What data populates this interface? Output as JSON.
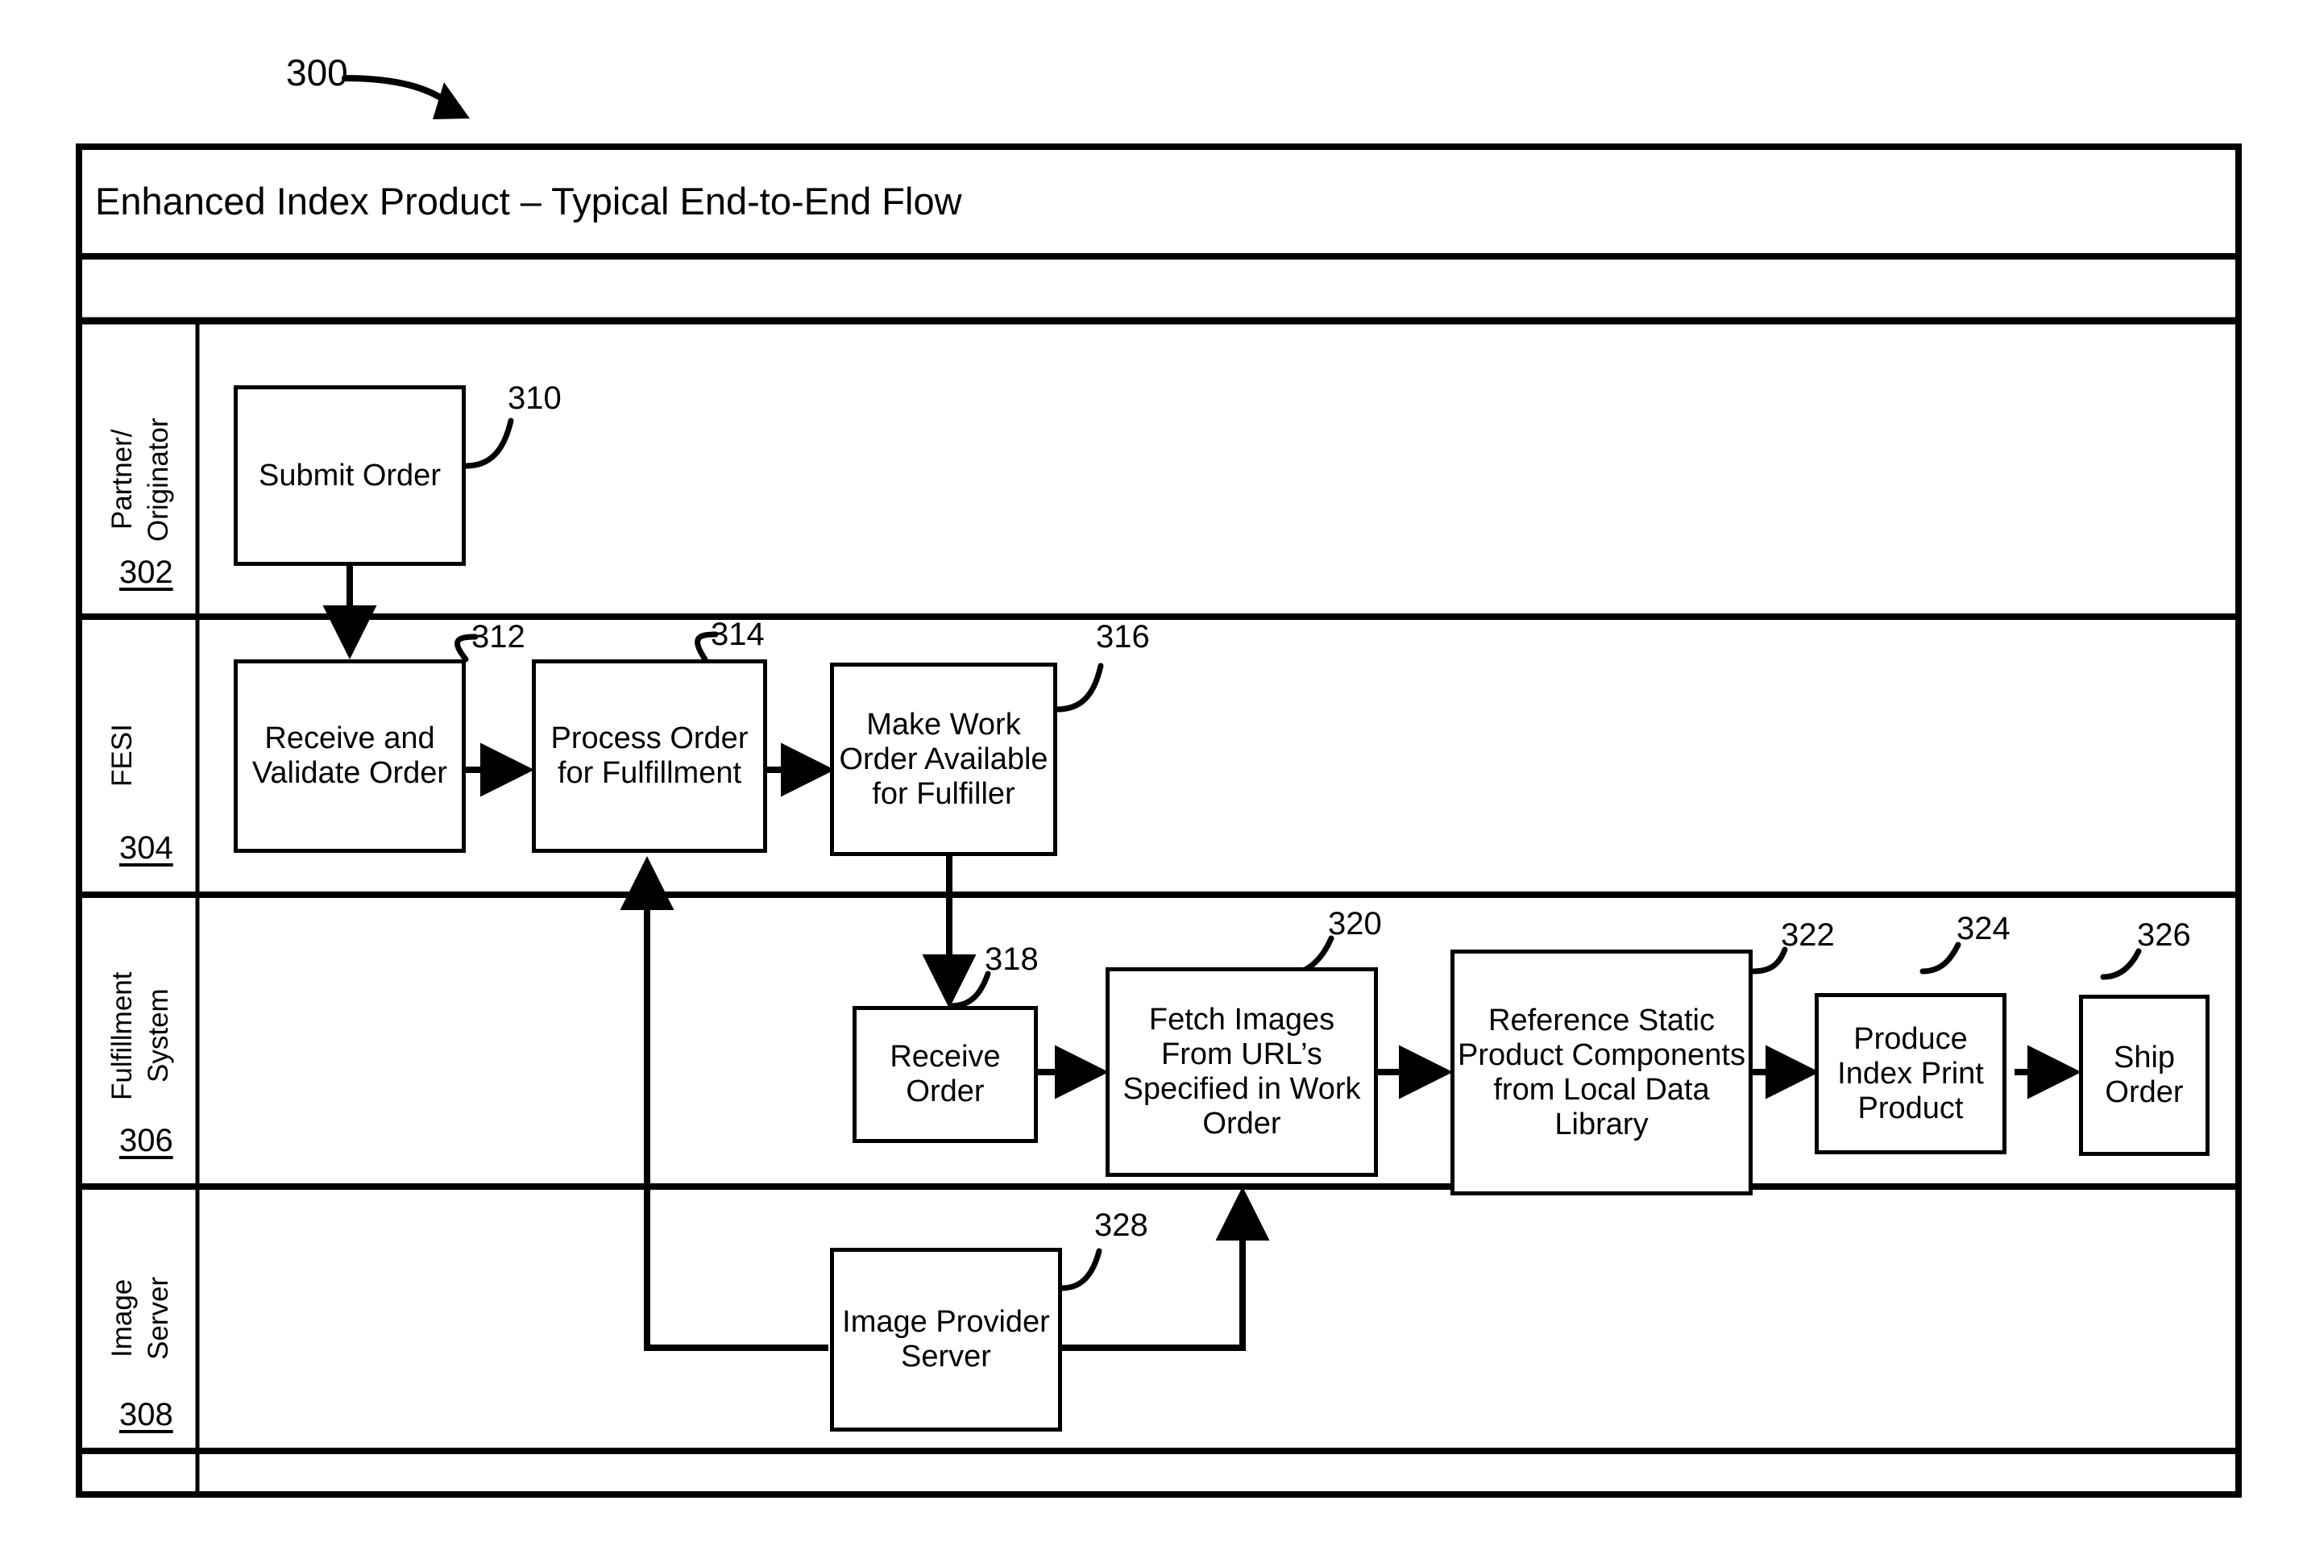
{
  "figure": {
    "number": "300",
    "title": "Enhanced Index Product – Typical End-to-End Flow"
  },
  "lanes": [
    {
      "id": "partner",
      "label": "Partner/\nOriginator",
      "ref": "302"
    },
    {
      "id": "fesi",
      "label": "FESI",
      "ref": "304"
    },
    {
      "id": "fulfillment",
      "label": "Fulfillment\nSystem",
      "ref": "306"
    },
    {
      "id": "image_server",
      "label": "Image\nServer",
      "ref": "308"
    }
  ],
  "nodes": [
    {
      "id": "n310",
      "ref": "310",
      "label": "Submit\nOrder",
      "lane": "partner"
    },
    {
      "id": "n312",
      "ref": "312",
      "label": "Receive and\nValidate\nOrder",
      "lane": "fesi"
    },
    {
      "id": "n314",
      "ref": "314",
      "label": "Process\nOrder for\nFulfillment",
      "lane": "fesi"
    },
    {
      "id": "n316",
      "ref": "316",
      "label": "Make Work\nOrder\nAvailable for\nFulfiller",
      "lane": "fesi"
    },
    {
      "id": "n318",
      "ref": "318",
      "label": "Receive\nOrder",
      "lane": "fulfillment"
    },
    {
      "id": "n320",
      "ref": "320",
      "label": "Fetch Images\nFrom URL’s\nSpecified in\nWork Order",
      "lane": "fulfillment"
    },
    {
      "id": "n322",
      "ref": "322",
      "label": "Reference Static\nProduct\nComponents\nfrom Local Data\nLibrary",
      "lane": "fulfillment"
    },
    {
      "id": "n324",
      "ref": "324",
      "label": "Produce\nIndex Print\nProduct",
      "lane": "fulfillment"
    },
    {
      "id": "n326",
      "ref": "326",
      "label": "Ship\nOrder",
      "lane": "fulfillment"
    },
    {
      "id": "n328",
      "ref": "328",
      "label": "Image\nProvider\nServer",
      "lane": "image_server"
    }
  ],
  "colors": {
    "stroke": "#000000",
    "background": "#ffffff"
  }
}
